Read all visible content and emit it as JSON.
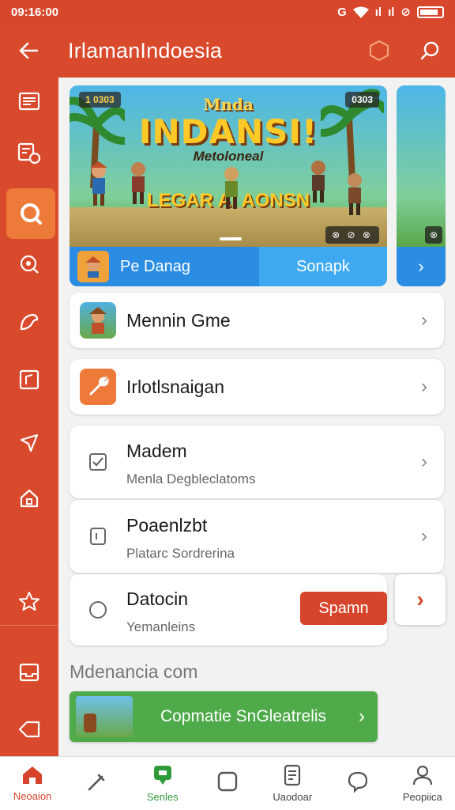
{
  "status_bar": {
    "time": "09:16:00",
    "signal_text": "ıl",
    "extra": "ıl"
  },
  "app_bar": {
    "title": "IrlamanIndoesia"
  },
  "banner": {
    "badge_left": "1 0303",
    "badge_right": "0303",
    "title_small": "Mnda",
    "title_big": "INDANSI!",
    "subtitle": "Metoloneal",
    "tagline": "LEGAR AI AONSN",
    "controls": "⊗ ⊘ ⊗",
    "bar_left_label": "Pe Danag",
    "bar_right_label": "Sonapk"
  },
  "list": [
    {
      "label": "Mennin Gme",
      "sub": ""
    },
    {
      "label": "Irlotlsnaigan",
      "sub": ""
    },
    {
      "label": "Madem",
      "sub": "Menla Degbleclatoms"
    },
    {
      "label": "Poaenlzbt",
      "sub": "Platarc Sordrerina"
    },
    {
      "label": "Datocin",
      "sub": "Yemanleins"
    }
  ],
  "spam_button": "Spamn",
  "section_title": "Mdenancia com",
  "promo_label": "Copmatie SnGleatrelis",
  "bottom_nav": [
    {
      "label": "Neoaion",
      "icon": "home-icon"
    },
    {
      "label": "",
      "icon": "tools-icon"
    },
    {
      "label": "Senles",
      "icon": "games-icon"
    },
    {
      "label": "",
      "icon": "square-icon"
    },
    {
      "label": "Uaodoar",
      "icon": "document-icon"
    },
    {
      "label": "",
      "icon": "chat-icon"
    },
    {
      "label": "Peopiica",
      "icon": "person-icon"
    }
  ],
  "colors": {
    "primary": "#d9492c",
    "accent": "#ee7a3a",
    "blue": "#2a8de3",
    "green": "#4faa4a"
  }
}
